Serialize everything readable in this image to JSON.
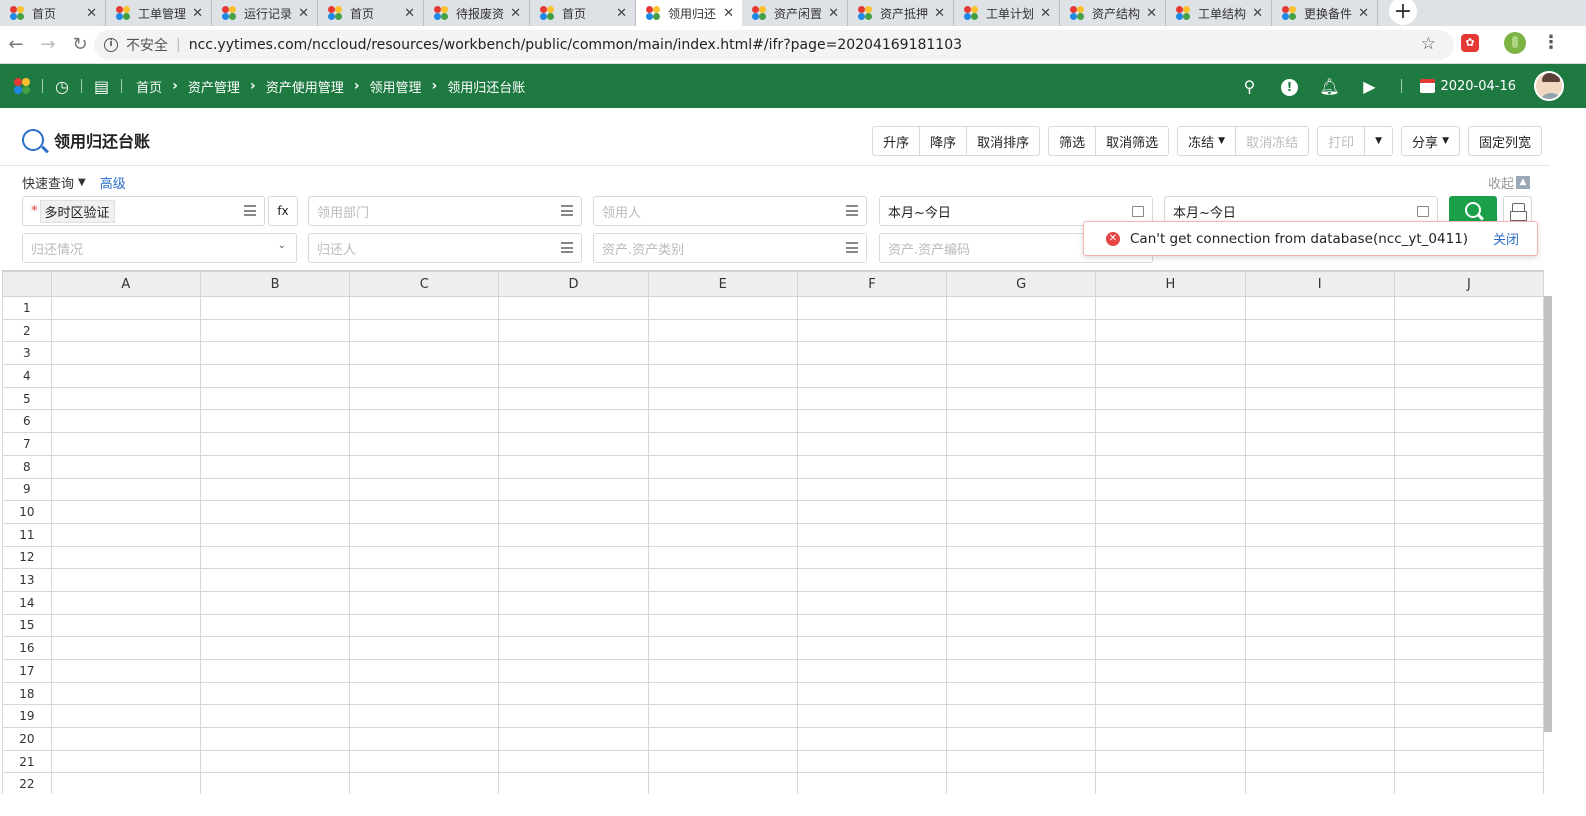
{
  "browser": {
    "tabs": [
      {
        "title": "首页"
      },
      {
        "title": "工单管理"
      },
      {
        "title": "运行记录"
      },
      {
        "title": "首页"
      },
      {
        "title": "待报废资"
      },
      {
        "title": "首页"
      },
      {
        "title": "领用归还"
      },
      {
        "title": "资产闲置"
      },
      {
        "title": "资产抵押"
      },
      {
        "title": "工单计划"
      },
      {
        "title": "资产结构"
      },
      {
        "title": "工单结构"
      },
      {
        "title": "更换备件"
      }
    ],
    "active_tab_index": 6,
    "insecure_label": "不安全",
    "url": "ncc.yytimes.com/nccloud/resources/workbench/public/common/main/index.html#/ifr?page=20204169181103"
  },
  "header": {
    "breadcrumb": [
      "首页",
      "资产管理",
      "资产使用管理",
      "领用管理",
      "领用归还台账"
    ],
    "date": "2020-04-16",
    "accent_color": "#1f7a42"
  },
  "page": {
    "title": "领用归还台账",
    "toolbar": {
      "sort_asc": "升序",
      "sort_desc": "降序",
      "cancel_sort": "取消排序",
      "filter": "筛选",
      "cancel_filter": "取消筛选",
      "freeze": "冻结",
      "cancel_freeze": "取消冻结",
      "print": "打印",
      "share": "分享",
      "fixed_width": "固定列宽"
    }
  },
  "query": {
    "quick_query": "快速查询",
    "advanced": "高级",
    "collapse": "收起",
    "fx": "fx",
    "fields": {
      "timezone_tag": "多时区验证",
      "dept_placeholder": "领用部门",
      "person_placeholder": "领用人",
      "date1_value": "本月~今日",
      "date2_value": "本月~今日",
      "return_status_placeholder": "归还情况",
      "return_person_placeholder": "归还人",
      "asset_category_placeholder": "资产.资产类别",
      "asset_code_placeholder": "资产.资产编码"
    }
  },
  "notice": {
    "message": "Can't get connection from database(ncc_yt_0411)",
    "close": "关闭"
  },
  "grid": {
    "columns": [
      "A",
      "B",
      "C",
      "D",
      "E",
      "F",
      "G",
      "H",
      "I",
      "J"
    ],
    "rows": [
      "1",
      "2",
      "3",
      "4",
      "5",
      "6",
      "7",
      "8",
      "9",
      "10",
      "11",
      "12",
      "13",
      "14",
      "15",
      "16",
      "17",
      "18",
      "19",
      "20",
      "21",
      "22"
    ]
  }
}
